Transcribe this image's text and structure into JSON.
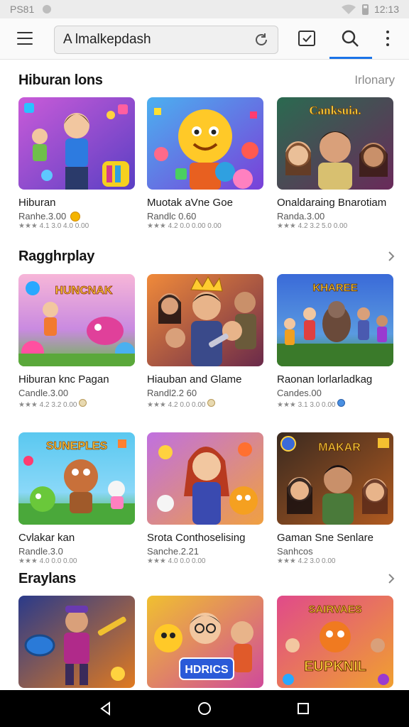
{
  "status_bar": {
    "time_left": "PS81",
    "time_right": "12:13"
  },
  "toolbar": {
    "search_value": "A lmalkepdash"
  },
  "sections": [
    {
      "title": "Hiburan lons",
      "link": "Irlonary",
      "cards": [
        {
          "title": "Hiburan",
          "subtitle": "Ranhe.3.00",
          "meta": "★★★ 4.1 3.0 4.0 0.00"
        },
        {
          "title": "Muotak aVne Goe",
          "subtitle": "Randlc 0.60",
          "meta": "★★★ 4.2 0.0 0.00 0.00"
        },
        {
          "title": "Onaldaraing Bnarotiam",
          "subtitle": "Randa.3.00",
          "meta": "★★★ 4.2 3.2 5.0 0.00"
        }
      ]
    },
    {
      "title": "Ragghrplay",
      "link": "",
      "cards": [
        {
          "title": "Hiburan knc Pagan",
          "subtitle": "Candle.3.00",
          "meta": "★★★ 4.2 3.2 0.00"
        },
        {
          "title": "Hiauban and Glame",
          "subtitle": "Randl2.2 60",
          "meta": "★★★ 4.2 0.0 0.00"
        },
        {
          "title": "Raonan lorlarladkag",
          "subtitle": "Candes.00",
          "meta": "★★★ 3.1 3.0 0.00"
        }
      ]
    },
    {
      "title": "",
      "link": "",
      "cards": [
        {
          "title": "Cvlakar kan",
          "subtitle": "Randle.3.0",
          "meta": "★★★ 4.0 0.0 0.00"
        },
        {
          "title": "Srota Conthoselising",
          "subtitle": "Sanche.2.21",
          "meta": "★★★ 4.0 0.0 0.00"
        },
        {
          "title": "Gaman Sne Senlare",
          "subtitle": "Sanhcos",
          "meta": "★★★ 4.2 3.0 0.00"
        }
      ]
    },
    {
      "title": "Eraylans",
      "link": "",
      "cards": [
        {
          "title": "",
          "subtitle": "",
          "meta": ""
        },
        {
          "title": "",
          "subtitle": "",
          "meta": ""
        },
        {
          "title": "",
          "subtitle": "",
          "meta": ""
        }
      ]
    }
  ],
  "thumb_texts": {
    "s0c2": "Canksuia.",
    "s1c0": "HUNCNAK",
    "s1c2": "KHAREE",
    "s2c0": "SUNEPLES",
    "s2c2": "MAKAR",
    "s3c1": "HDRICS",
    "s3c2": "EUPKNIL"
  },
  "colors": {
    "accent": "#1a73e8",
    "nav_bar": "#000000",
    "status_bar": "#ececec"
  },
  "icons": [
    "menu-icon",
    "refresh-icon",
    "check-icon",
    "search-icon",
    "more-icon",
    "chevron-icon",
    "back-icon",
    "home-icon",
    "recents-icon"
  ]
}
